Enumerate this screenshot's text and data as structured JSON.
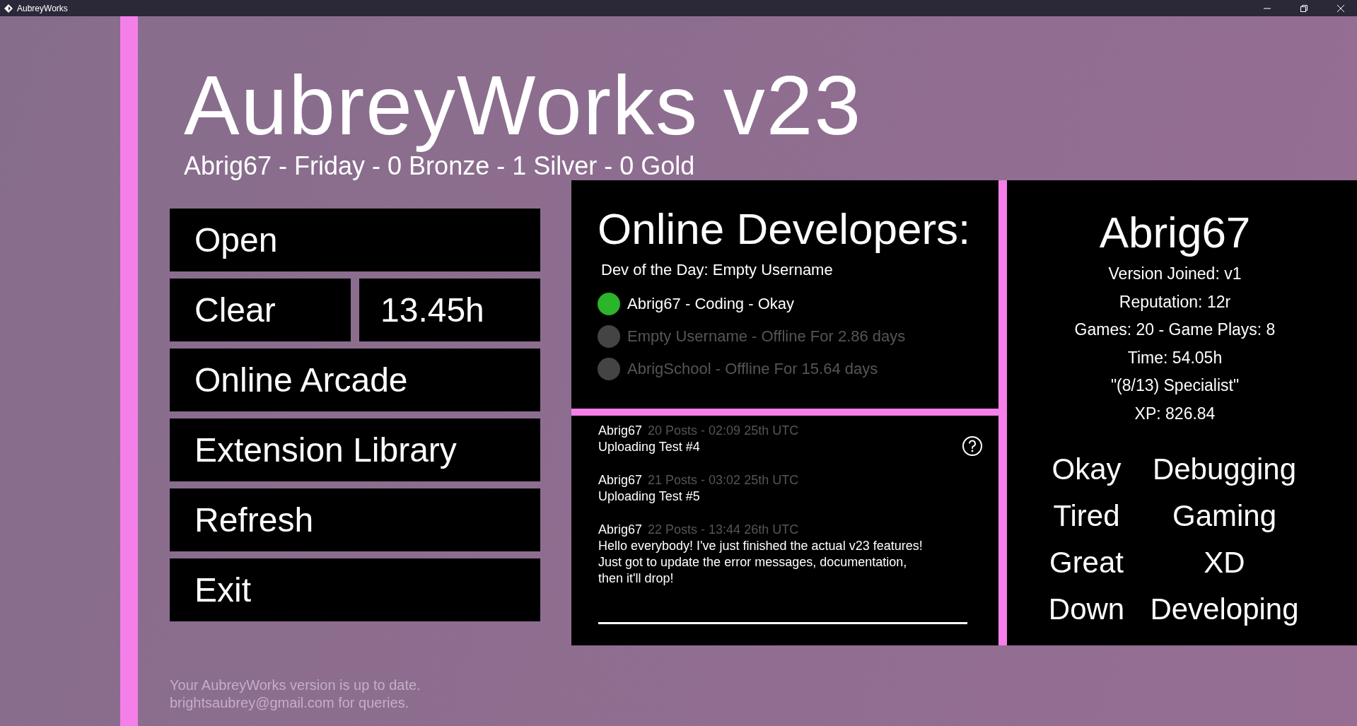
{
  "window": {
    "title": "AubreyWorks"
  },
  "header": {
    "title": "AubreyWorks v23",
    "subtitle": "Abrig67 - Friday - 0 Bronze - 1 Silver - 0 Gold"
  },
  "menu_rows": [
    [
      {
        "kind": "button",
        "label": "Open"
      }
    ],
    [
      {
        "kind": "button",
        "label": "Clear"
      },
      {
        "kind": "readout",
        "label": "13.45h"
      }
    ],
    [
      {
        "kind": "button",
        "label": "Online Arcade"
      }
    ],
    [
      {
        "kind": "button",
        "label": "Extension Library"
      }
    ],
    [
      {
        "kind": "button",
        "label": "Refresh"
      }
    ],
    [
      {
        "kind": "button",
        "label": "Exit"
      }
    ]
  ],
  "online_developers": {
    "title": "Online Developers:",
    "dev_of_the_day": "Dev of the Day: Empty Username",
    "developers": [
      {
        "text": "Abrig67 - Coding - Okay",
        "online": true
      },
      {
        "text": "Empty Username - Offline For 2.86 days",
        "online": false
      },
      {
        "text": "AbrigSchool - Offline For 15.64 days",
        "online": false
      }
    ]
  },
  "posts": {
    "items": [
      {
        "author": "Abrig67",
        "meta": "20 Posts - 02:09 25th UTC",
        "text": "Uploading Test #4"
      },
      {
        "author": "Abrig67",
        "meta": "21 Posts - 03:02 25th UTC",
        "text": "Uploading Test #5"
      },
      {
        "author": "Abrig67",
        "meta": "22 Posts - 13:44 26th UTC",
        "text": "Hello everybody! I've just finished the actual v23 features! Just got to update the error messages, documentation, then it'll drop!"
      }
    ]
  },
  "profile": {
    "name": "Abrig67",
    "stats": [
      "Version Joined: v1",
      "Reputation: 12r",
      "Games: 20 - Game Plays: 8",
      "Time: 54.05h",
      "\"(8/13)  Specialist\"",
      "XP: 826.84"
    ],
    "statuses": [
      "Okay",
      "Debugging",
      "Tired",
      "Gaming",
      "Great",
      "XD",
      "Down",
      "Developing"
    ]
  },
  "footer": [
    "Your AubreyWorks version is up to date.",
    "brightsaubrey@gmail.com for queries."
  ]
}
